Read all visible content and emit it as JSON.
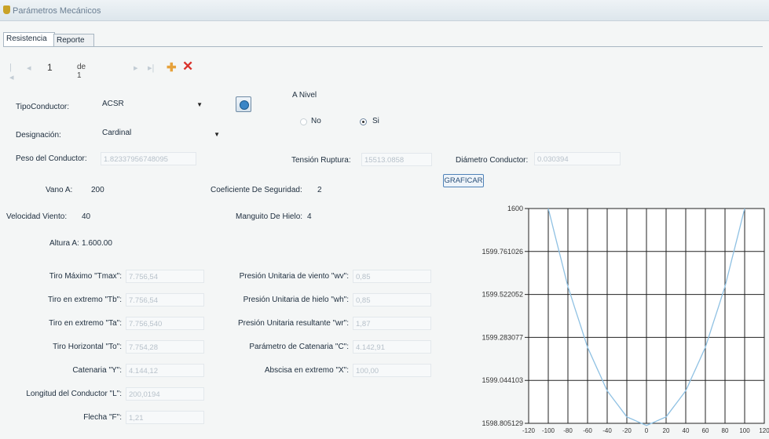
{
  "window": {
    "title": "Parámetros Mecánicos"
  },
  "tabs": [
    {
      "label": "Resistencia"
    },
    {
      "label": "Reporte"
    }
  ],
  "navigator": {
    "position": "1",
    "count_label": "de 1"
  },
  "form": {
    "tipo_conductor": {
      "label": "TipoConductor:",
      "value": "ACSR"
    },
    "designacion": {
      "label": "Designación:",
      "value": "Cardinal"
    },
    "a_nivel": {
      "label": "A Nivel",
      "no_label": "No",
      "si_label": "Si",
      "selected": "Si"
    },
    "peso_conductor": {
      "label": "Peso del Conductor:",
      "value": "1.82337956748095"
    },
    "tension_ruptura": {
      "label": "Tensión Ruptura:",
      "value": "15513.0858"
    },
    "diametro_conductor": {
      "label": "Diámetro Conductor:",
      "value": "0.030394"
    },
    "graficar_label": "GRAFICAR",
    "vano_a": {
      "label": "Vano A:",
      "value": "200"
    },
    "coef_seguridad": {
      "label": "Coeficiente De Seguridad:",
      "value": "2"
    },
    "velocidad_viento": {
      "label": "Velocidad Viento:",
      "value": "40"
    },
    "manguito_hielo": {
      "label": "Manguito De Hielo:",
      "value": "4"
    },
    "altura_a": {
      "label": "Altura A:",
      "value": "1.600.00"
    }
  },
  "results_left": [
    {
      "label": "Tiro Máximo \"Tmax\":",
      "value": "7.756,54"
    },
    {
      "label": "Tiro en extremo \"Tb\":",
      "value": "7.756,54"
    },
    {
      "label": "Tiro en extremo \"Ta\":",
      "value": "7.756,540"
    },
    {
      "label": "Tiro Horizontal \"To\":",
      "value": "7.754,28"
    },
    {
      "label": "Catenaria \"Y\":",
      "value": "4.144,12"
    },
    {
      "label": "Longitud del Conductor \"L\":",
      "value": "200,0194"
    },
    {
      "label": "Flecha \"F\":",
      "value": "1,21"
    }
  ],
  "results_right": [
    {
      "label": "Presión Unitaria de viento \"wv\":",
      "value": "0,85"
    },
    {
      "label": "Presión Unitaria de hielo \"wh\":",
      "value": "0,85"
    },
    {
      "label": "Presión Unitaria resultante \"wr\":",
      "value": "1,87"
    },
    {
      "label": "Parámetro de Catenaria \"C\":",
      "value": "4.142,91"
    },
    {
      "label": "Abscisa en extremo \"X\":",
      "value": "100,00"
    }
  ],
  "chart_data": {
    "type": "line",
    "title": "",
    "xlabel": "",
    "ylabel": "",
    "xlim": [
      -120,
      120
    ],
    "ylim": [
      1598.805129,
      1600
    ],
    "grid": true,
    "x_ticks": [
      -120,
      -100,
      -80,
      -60,
      -40,
      -20,
      0,
      20,
      40,
      60,
      80,
      100,
      120
    ],
    "x_tick_labels": [
      "-120",
      "-100",
      "-80",
      "-60",
      "-40",
      "-20",
      "0",
      "20",
      "40",
      "60",
      "80",
      "100",
      "120"
    ],
    "y_ticks": [
      1600,
      1599.761026,
      1599.522052,
      1599.283077,
      1599.044103,
      1598.805129
    ],
    "y_tick_labels": [
      "1600",
      "1599.761026",
      "1599.522052",
      "1599.283077",
      "1599.044103",
      "1598.805129"
    ],
    "series": [
      {
        "color": "#8fc1e3",
        "x": [
          -100,
          -80,
          -60,
          -40,
          -20,
          0,
          20,
          40,
          60,
          80,
          100
        ],
        "y": [
          1600,
          1599.566,
          1599.228,
          1598.986,
          1598.841,
          1598.793,
          1598.841,
          1598.986,
          1599.228,
          1599.566,
          1600
        ]
      }
    ]
  }
}
